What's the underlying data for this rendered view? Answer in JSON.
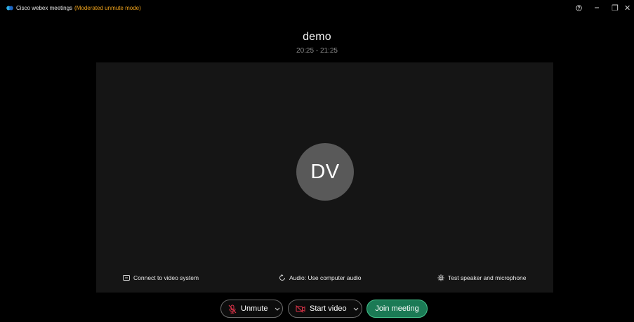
{
  "titlebar": {
    "app_name": "Cisco webex meetings",
    "mode": "(Moderated unmute mode)",
    "icons": [
      "webex-logo-icon",
      "help-icon",
      "minimize-icon",
      "restore-icon",
      "close-icon"
    ],
    "restore_glyph": "❐",
    "close_glyph": "✕"
  },
  "meeting": {
    "title": "demo",
    "time": "20:25 - 21:25"
  },
  "preview": {
    "avatar_initials": "DV",
    "links": {
      "video_system": "Connect to video system",
      "audio": "Audio: Use computer audio",
      "test": "Test speaker and microphone"
    }
  },
  "controls": {
    "unmute_label": "Unmute",
    "start_video_label": "Start video",
    "join_label": "Join meeting"
  },
  "colors": {
    "background": "#000000",
    "preview": "#151515",
    "mode_text": "#f0a31b",
    "join_bg": "#1b7a55",
    "muted_icon": "#e0344a"
  }
}
